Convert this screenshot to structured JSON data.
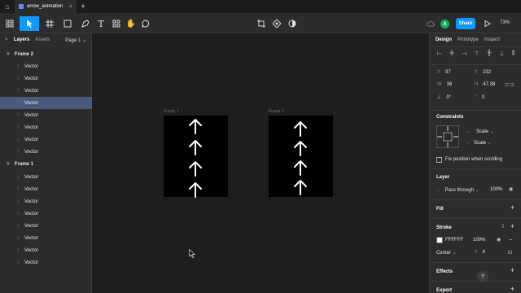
{
  "tabs": {
    "file_name": "arrow_animation"
  },
  "toolbar": {
    "avatar_initial": "A",
    "share_label": "Share",
    "zoom": "73%"
  },
  "layers_panel": {
    "tab_layers": "Layers",
    "tab_assets": "Assets",
    "page": "Page 1",
    "rows": [
      {
        "label": "Frame 2",
        "kind": "frame"
      },
      {
        "label": "Vector",
        "kind": "vector"
      },
      {
        "label": "Vector",
        "kind": "vector"
      },
      {
        "label": "Vector",
        "kind": "vector"
      },
      {
        "label": "Vector",
        "kind": "vector",
        "selected": true
      },
      {
        "label": "Vector",
        "kind": "vector"
      },
      {
        "label": "Vector",
        "kind": "vector"
      },
      {
        "label": "Vector",
        "kind": "vector"
      },
      {
        "label": "Vector",
        "kind": "vector"
      },
      {
        "label": "Frame 1",
        "kind": "frame"
      },
      {
        "label": "Vector",
        "kind": "vector"
      },
      {
        "label": "Vector",
        "kind": "vector"
      },
      {
        "label": "Vector",
        "kind": "vector"
      },
      {
        "label": "Vector",
        "kind": "vector"
      },
      {
        "label": "Vector",
        "kind": "vector"
      },
      {
        "label": "Vector",
        "kind": "vector"
      },
      {
        "label": "Vector",
        "kind": "vector"
      },
      {
        "label": "Vector",
        "kind": "vector"
      }
    ]
  },
  "canvas": {
    "frame1_label": "Frame 1",
    "frame2_label": "Frame 2",
    "frame_fill": "#000000",
    "arrow_color": "#ffffff"
  },
  "design_panel": {
    "tab_design": "Design",
    "tab_prototype": "Prototype",
    "tab_inspect": "Inspect",
    "x_label": "X",
    "x": "97",
    "y_label": "Y",
    "y": "232",
    "w_label": "W",
    "w": "36",
    "h_label": "H",
    "h": "47.38",
    "rotation": "0°",
    "radius": "0",
    "constraints_title": "Constraints",
    "constraint_h": "Scale",
    "constraint_v": "Scale",
    "fix_position": "Fix position when scrolling",
    "layer_title": "Layer",
    "blend_mode": "Pass through",
    "layer_opacity": "100%",
    "fill_title": "Fill",
    "stroke_title": "Stroke",
    "stroke_color": "FFFFFF",
    "stroke_opacity": "100%",
    "stroke_position": "Center",
    "stroke_weight": "4",
    "effects_title": "Effects",
    "export_title": "Export"
  },
  "help": "?"
}
